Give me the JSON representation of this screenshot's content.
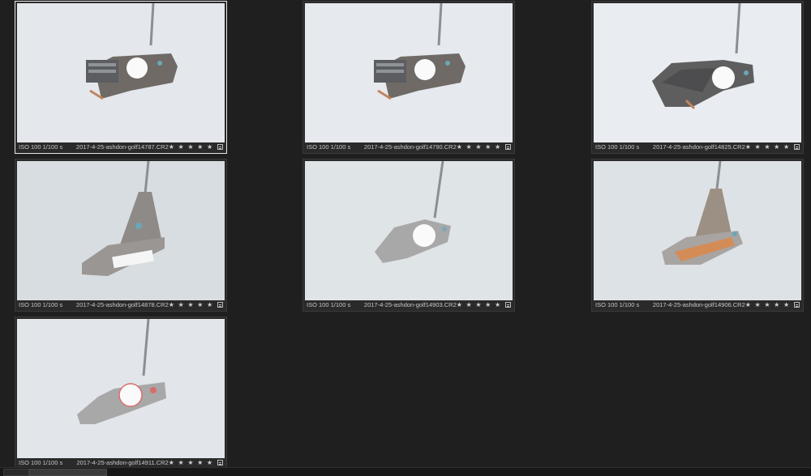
{
  "thumbnails": [
    {
      "exif": "ISO 100 1/100 s",
      "filename": "2017-4-25-ashdon-golf14787.CR2",
      "rating": "★ ★ ★ ★ ★",
      "selected": true,
      "photo_icon": "mallet-putter-photo",
      "bg": "#e4e8ec"
    },
    {
      "exif": "ISO 100 1/100 s",
      "filename": "2017-4-25-ashdon-golf14790.CR2",
      "rating": "★ ★ ★ ★ ★",
      "selected": false,
      "photo_icon": "mallet-putter-photo",
      "bg": "#e6eaee"
    },
    {
      "exif": "ISO 100 1/100 s",
      "filename": "2017-4-25-ashdon-golf14825.CR2",
      "rating": "★ ★ ★ ★ ★",
      "selected": false,
      "photo_icon": "winged-mallet-putter-photo",
      "bg": "#e9edf1"
    },
    {
      "exif": "ISO 100 1/100 s",
      "filename": "2017-4-25-ashdon-golf14878.CR2",
      "rating": "★ ★ ★ ★ ★",
      "selected": false,
      "photo_icon": "blade-putter-photo",
      "bg": "#d8dde1"
    },
    {
      "exif": "ISO 100 1/100 s",
      "filename": "2017-4-25-ashdon-golf14903.CR2",
      "rating": "★ ★ ★ ★ ★",
      "selected": false,
      "photo_icon": "round-putter-photo",
      "bg": "#dfe4e7"
    },
    {
      "exif": "ISO 100 1/100 s",
      "filename": "2017-4-25-ashdon-golf14906.CR2",
      "rating": "★ ★ ★ ★ ★",
      "selected": false,
      "photo_icon": "copper-face-putter-photo",
      "bg": "#dde2e6"
    },
    {
      "exif": "ISO 100 1/100 s",
      "filename": "2017-4-25-ashdon-golf14911.CR2",
      "rating": "★ ★ ★ ★ ★",
      "selected": false,
      "photo_icon": "bridge-putter-photo",
      "bg": "#e2e6ea"
    }
  ],
  "colors": {
    "background": "#1f1f1f",
    "selection": "#e8e8e8",
    "text": "#c8c8c8"
  }
}
